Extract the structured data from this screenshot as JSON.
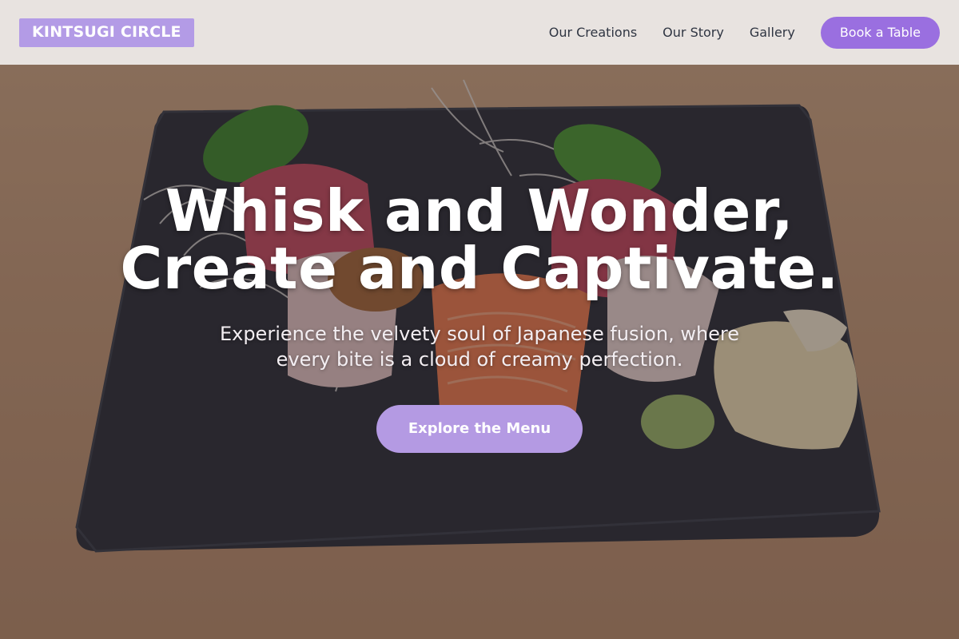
{
  "brand": {
    "name": "KINTSUGI CIRCLE"
  },
  "nav": {
    "links": [
      "Our Creations",
      "Our Story",
      "Gallery"
    ],
    "cta_label": "Book a Table"
  },
  "hero": {
    "title_line1": "Whisk and Wonder,",
    "title_line2": "Create and Captivate.",
    "subtitle": "Experience the velvety soul of Japanese fusion, where every bite is a cloud of creamy perfection.",
    "cta_label": "Explore the Menu",
    "background_image": "sashimi-platter-on-slate-photo"
  },
  "colors": {
    "brand_bg": "#b39be6",
    "primary_button": "#9a6fe0",
    "hero_button": "#b49ae3",
    "nav_text": "#2f3542",
    "header_bg": "#ece8e6"
  }
}
